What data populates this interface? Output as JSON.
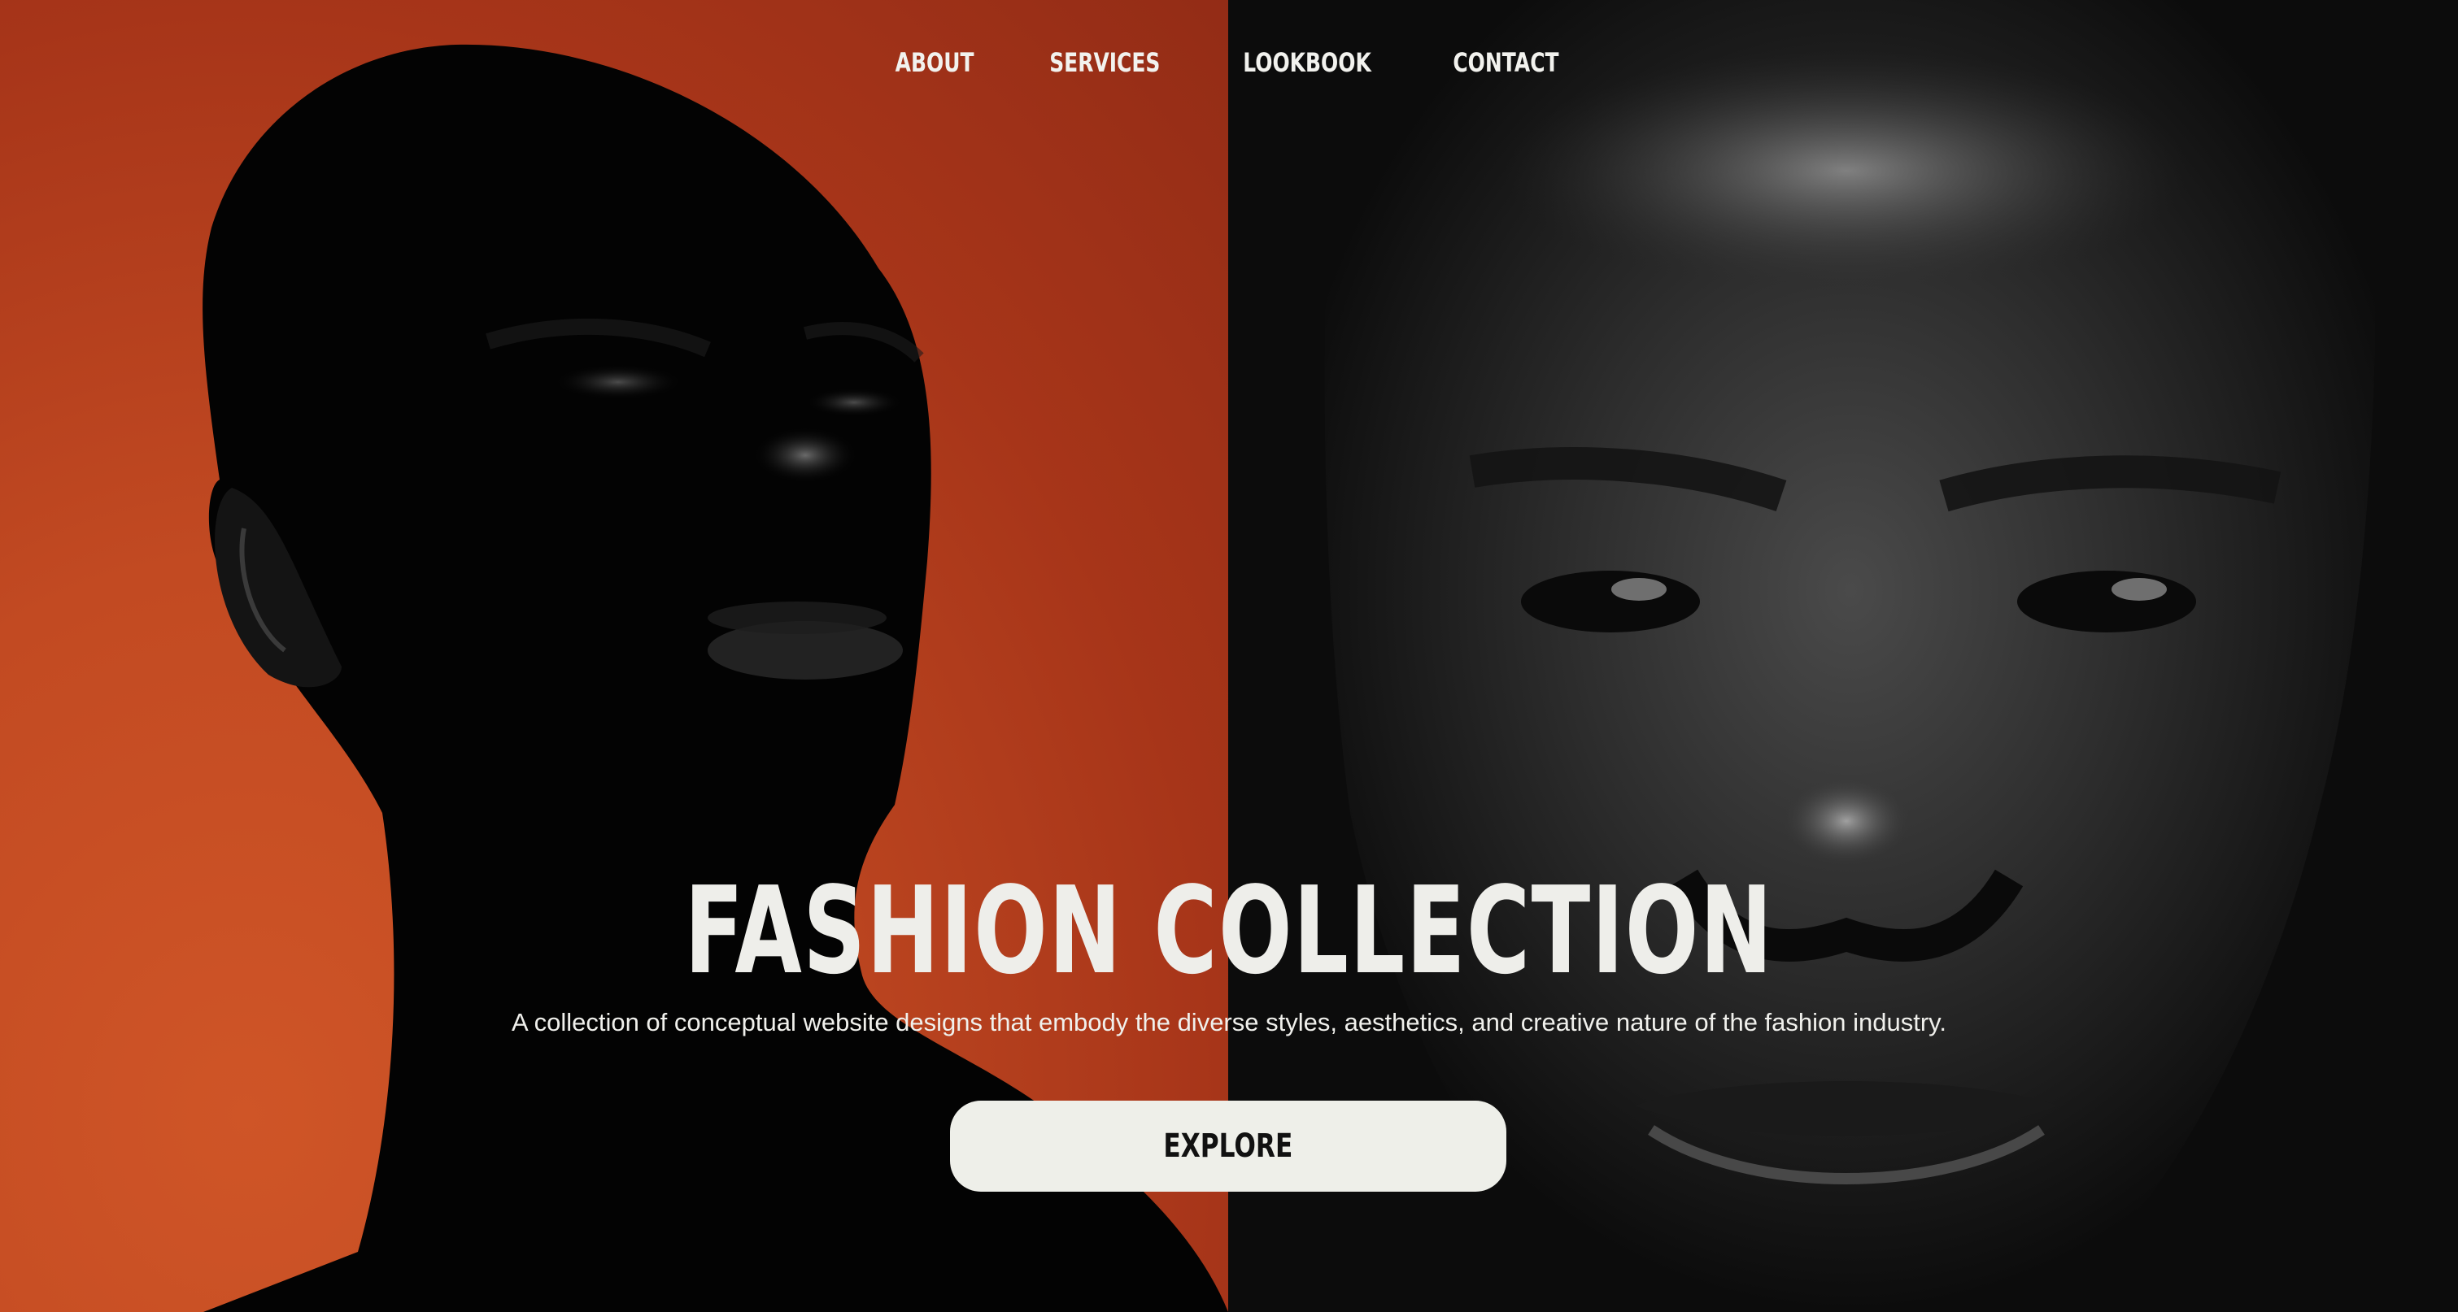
{
  "nav": {
    "items": [
      {
        "label": "ABOUT"
      },
      {
        "label": "SERVICES"
      },
      {
        "label": "LOOKBOOK"
      },
      {
        "label": "CONTACT"
      }
    ]
  },
  "hero": {
    "title": "FASHION COLLECTION",
    "subtitle": "A collection of conceptual website designs that embody the diverse styles, aesthetics, and creative nature of the fashion industry.",
    "cta_label": "EXPLORE"
  },
  "colors": {
    "accent_orange": "#c24a22",
    "dark": "#0c0c0c",
    "light_text": "#eeeeea",
    "button_bg": "#eeefe9"
  }
}
